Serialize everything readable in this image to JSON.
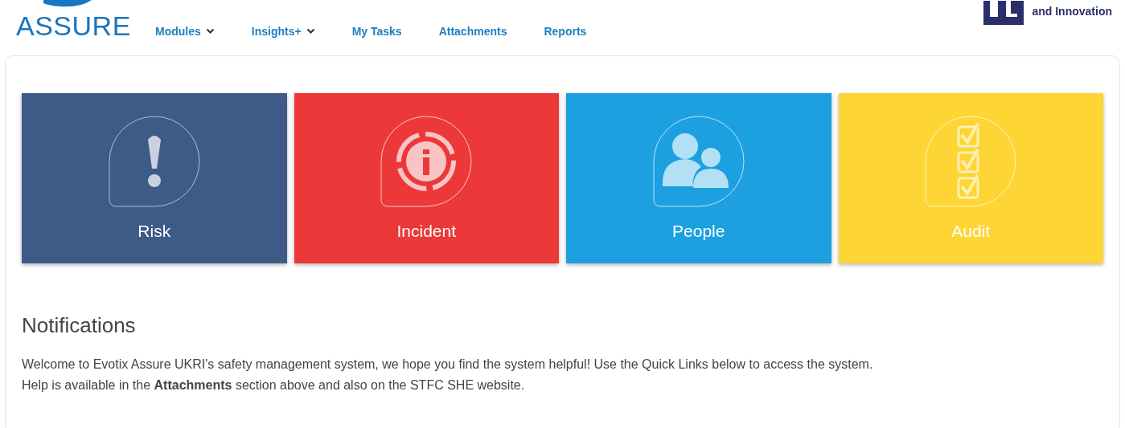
{
  "header": {
    "logo_text": "ASSURE",
    "partner_text": "and Innovation"
  },
  "nav": [
    {
      "label": "Modules",
      "dropdown": true
    },
    {
      "label": "Insights+",
      "dropdown": true
    },
    {
      "label": "My Tasks",
      "dropdown": false
    },
    {
      "label": "Attachments",
      "dropdown": false
    },
    {
      "label": "Reports",
      "dropdown": false
    }
  ],
  "tiles": [
    {
      "label": "Risk",
      "kind": "risk",
      "color": "#3e5a87"
    },
    {
      "label": "Incident",
      "kind": "incident",
      "color": "#ec3839"
    },
    {
      "label": "People",
      "kind": "people",
      "color": "#1ca0e0"
    },
    {
      "label": "Audit",
      "kind": "audit",
      "color": "#fdd535"
    }
  ],
  "notifications": {
    "title": "Notifications",
    "lines": [
      "Welcome to Evotix Assure UKRI's safety management system, we hope you find the system helpful! Use the Quick Links below to access the system.",
      "Help is available in the **Attachments** section above and also on the STFC SHE website."
    ]
  }
}
